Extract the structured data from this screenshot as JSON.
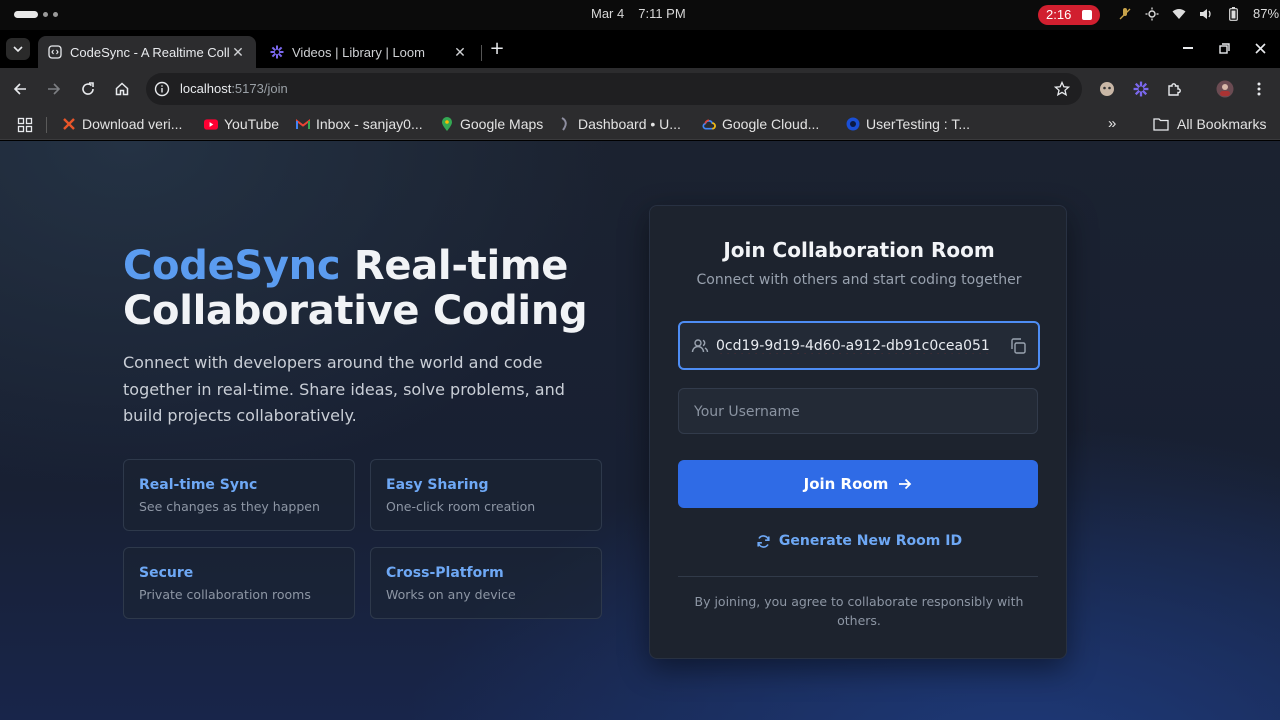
{
  "os": {
    "date": "Mar 4",
    "time": "7:11 PM",
    "recording": "2:16",
    "battery": "87%"
  },
  "tabs": [
    {
      "title": "CodeSync - A Realtime Collaborative",
      "icon": "codesync-icon",
      "active": true
    },
    {
      "title": "Videos | Library | Loom",
      "icon": "loom-icon",
      "active": false
    }
  ],
  "address": {
    "host": "localhost",
    "path": ":5173/join"
  },
  "bookmarks": [
    {
      "label": "Download veri...",
      "icon": "x-icon",
      "color": "#e8562a"
    },
    {
      "label": "YouTube",
      "icon": "youtube-icon",
      "color": "#ff0033"
    },
    {
      "label": "Inbox - sanjay0...",
      "icon": "gmail-icon",
      "color": "#ea4335"
    },
    {
      "label": "Google Maps",
      "icon": "maps-icon",
      "color": "#34a853"
    },
    {
      "label": "Dashboard • U...",
      "icon": "dashboard-icon",
      "color": "#8e8ea0"
    },
    {
      "label": "Google Cloud...",
      "icon": "gcloud-icon",
      "color": "#4285f4"
    },
    {
      "label": "UserTesting : T...",
      "icon": "usertesting-icon",
      "color": "#1a4fd6"
    }
  ],
  "all_bookmarks": "All Bookmarks",
  "hero": {
    "brand": "CodeSync",
    "title_rest_1": " Real-time",
    "title_rest_2": "Collaborative Coding",
    "description": "Connect with developers around the world and code together in real-time. Share ideas, solve problems, and build projects collaboratively."
  },
  "features": [
    {
      "title": "Real-time Sync",
      "desc": "See changes as they happen"
    },
    {
      "title": "Easy Sharing",
      "desc": "One-click room creation"
    },
    {
      "title": "Secure",
      "desc": "Private collaboration rooms"
    },
    {
      "title": "Cross-Platform",
      "desc": "Works on any device"
    }
  ],
  "join_card": {
    "title": "Join Collaboration Room",
    "subtitle": "Connect with others and start coding together",
    "room_id_value": "0cd19-9d19-4d60-a912-db91c0cea051",
    "username_placeholder": "Your Username",
    "join_label": "Join Room",
    "generate_label": "Generate New Room ID",
    "terms": "By joining, you agree to collaborate responsibly with others."
  },
  "colors": {
    "accent": "#2f6be6",
    "brand_text": "#5b9cf0",
    "recording": "#d11f2f"
  }
}
